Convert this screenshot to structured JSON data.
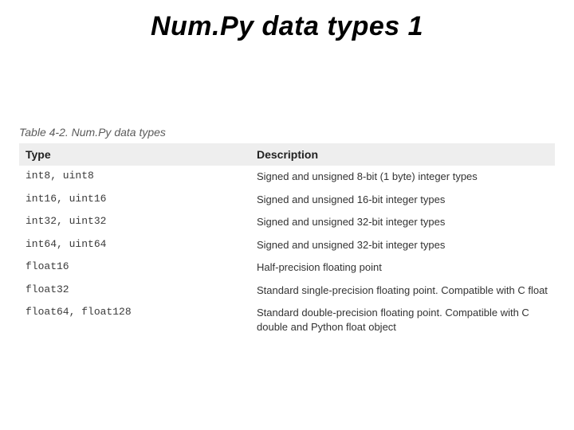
{
  "title": "Num.Py data types 1",
  "caption": "Table 4-2. Num.Py data types",
  "headers": {
    "type": "Type",
    "desc": "Description"
  },
  "rows": [
    {
      "type": "int8, uint8",
      "desc": "Signed and unsigned 8-bit (1 byte) integer types"
    },
    {
      "type": "int16, uint16",
      "desc": "Signed and unsigned 16-bit integer types"
    },
    {
      "type": "int32, uint32",
      "desc": "Signed and unsigned 32-bit integer types"
    },
    {
      "type": "int64, uint64",
      "desc": "Signed and unsigned 32-bit integer types"
    },
    {
      "type": "float16",
      "desc": "Half-precision floating point"
    },
    {
      "type": "float32",
      "desc": "Standard single-precision floating point. Compatible with C float"
    },
    {
      "type": "float64, float128",
      "desc": "Standard double-precision floating point. Compatible with C double and Python float object"
    }
  ]
}
